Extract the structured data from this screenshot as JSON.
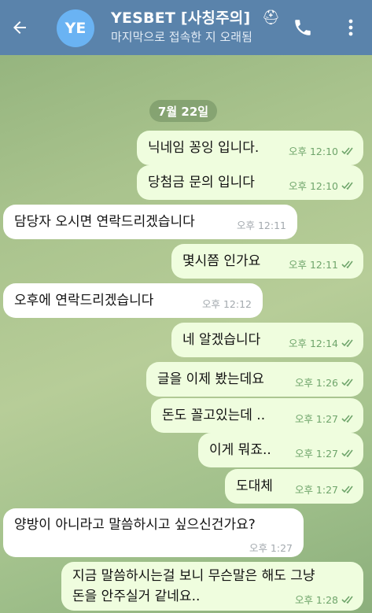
{
  "header": {
    "avatar_initials": "YE",
    "title": "YESBET [사칭주의]",
    "subtitle": "마지막으로 접속한 지 오래됨"
  },
  "date_label": "7월 22일",
  "messages": [
    {
      "dir": "out",
      "text": "닉네임 꽁잉 입니다.",
      "time": "오후 12:10",
      "read": true
    },
    {
      "dir": "out",
      "text": "당첨금 문의 입니다",
      "time": "오후 12:10",
      "read": true
    },
    {
      "dir": "in",
      "text": "담당자 오시면 연락드리겠습니다",
      "time": "오후 12:11"
    },
    {
      "dir": "out",
      "text": "몇시쯤 인가요",
      "time": "오후 12:11",
      "read": true
    },
    {
      "dir": "in",
      "text": "오후에 연락드리겠습니다",
      "time": "오후 12:12"
    },
    {
      "dir": "out",
      "text": "네 알겠습니다",
      "time": "오후 12:14",
      "read": true
    },
    {
      "dir": "out",
      "text": "글을 이제 봤는데요",
      "time": "오후 1:26",
      "read": true
    },
    {
      "dir": "out",
      "text": "돈도 꼴고있는데 ..",
      "time": "오후 1:27",
      "read": true
    },
    {
      "dir": "out",
      "text": "이게 뭐죠..",
      "time": "오후 1:27",
      "read": true
    },
    {
      "dir": "out",
      "text": "도대체",
      "time": "오후 1:27",
      "read": true
    },
    {
      "dir": "in",
      "text": "양방이 아니라고 말씀하시고 싶으신건가요?",
      "time": "오후 1:27"
    },
    {
      "dir": "out",
      "text": "지금 말씀하시는걸 보니 무슨말은 해도 그냥",
      "text2": "돈을 안주실거 같네요..",
      "time": "오후 1:28",
      "read": true
    }
  ],
  "colors": {
    "header_bg": "#5a83ab",
    "outgoing_bubble": "#effdde",
    "incoming_bubble": "#ffffff",
    "read_check": "#6fa56b"
  }
}
